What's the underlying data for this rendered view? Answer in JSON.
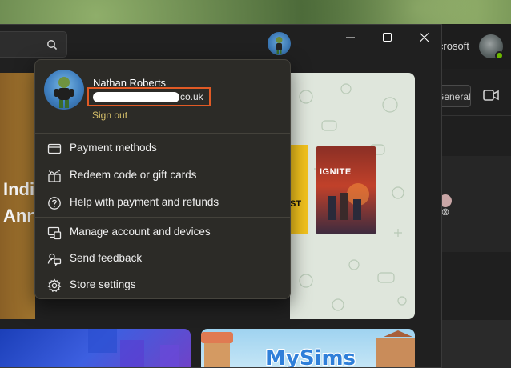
{
  "background_window": {
    "brand_fragment": "icrosoft",
    "general_chip": "General",
    "presence_color": "#6bb700"
  },
  "store": {
    "window_controls": {
      "minimize": "minimize-icon",
      "maximize": "maximize-icon",
      "close": "close-icon"
    },
    "hero": {
      "line1": "Indi",
      "line2": "Ann",
      "card_title": "IGNITE",
      "card_tag": "ST"
    },
    "bottom_tiles": {
      "sims_logo": "MySims"
    }
  },
  "account_menu": {
    "user_name": "Nathan Roberts",
    "email_visible_suffix": "co.uk",
    "sign_out": "Sign out",
    "accent_color": "#d9c26b",
    "highlight_color": "#e15a25",
    "items": [
      {
        "label": "Payment methods",
        "icon": "credit-card-icon"
      },
      {
        "label": "Redeem code or gift cards",
        "icon": "gift-icon"
      },
      {
        "label": "Help with payment and refunds",
        "icon": "help-icon"
      },
      {
        "label": "Manage account and devices",
        "icon": "devices-icon"
      },
      {
        "label": "Send feedback",
        "icon": "feedback-icon"
      },
      {
        "label": "Store settings",
        "icon": "gear-icon"
      }
    ]
  }
}
